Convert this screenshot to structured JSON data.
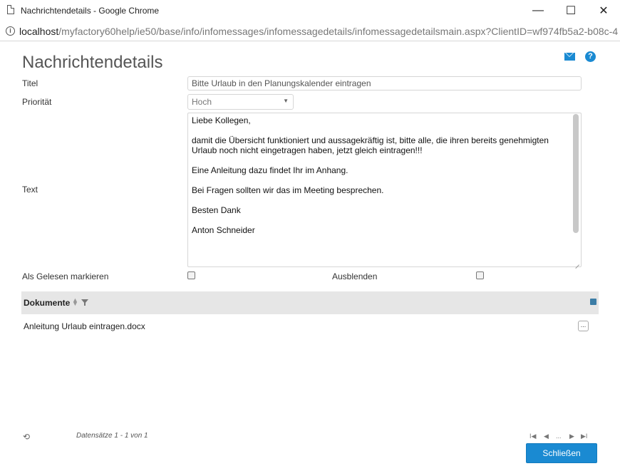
{
  "browser": {
    "window_title": "Nachrichtendetails - Google Chrome",
    "url_host": "localhost",
    "url_path": "/myfactory60help/ie50/base/info/infomessages/infomessagedetails/infomessagedetailsmain.aspx?ClientID=wf974fb5a2-b08c-4",
    "minimize_glyph": "—",
    "maximize_glyph": "☐",
    "close_glyph": "✕"
  },
  "page": {
    "title": "Nachrichtendetails",
    "help_glyph": "?"
  },
  "form": {
    "title_label": "Titel",
    "title_value": "Bitte Urlaub in den Planungskalender eintragen",
    "priority_label": "Priorität",
    "priority_value": "Hoch",
    "text_label": "Text",
    "text_paragraphs": [
      "Liebe Kollegen,",
      "damit die Übersicht funktioniert und aussagekräftig ist, bitte alle, die ihren bereits genehmigten Urlaub noch nicht eingetragen haben, jetzt gleich eintragen!!!",
      "Eine Anleitung dazu findet Ihr im Anhang.",
      "Bei Fragen sollten wir das im Meeting besprechen.",
      "Besten Dank",
      "Anton Schneider"
    ],
    "mark_read_label": "Als Gelesen markieren",
    "hide_label": "Ausblenden"
  },
  "grid": {
    "column_header": "Dokumente",
    "rows": [
      "Anleitung Urlaub eintragen.docx"
    ],
    "row_menu_glyph": "..."
  },
  "footer": {
    "records_text": "Datensätze 1 - 1 von 1",
    "refresh_glyph": "⟲",
    "pager_first": "I◀",
    "pager_prev": "◀",
    "pager_ellipsis": "...",
    "pager_next": "▶",
    "pager_last": "▶I",
    "close_button": "Schließen"
  }
}
